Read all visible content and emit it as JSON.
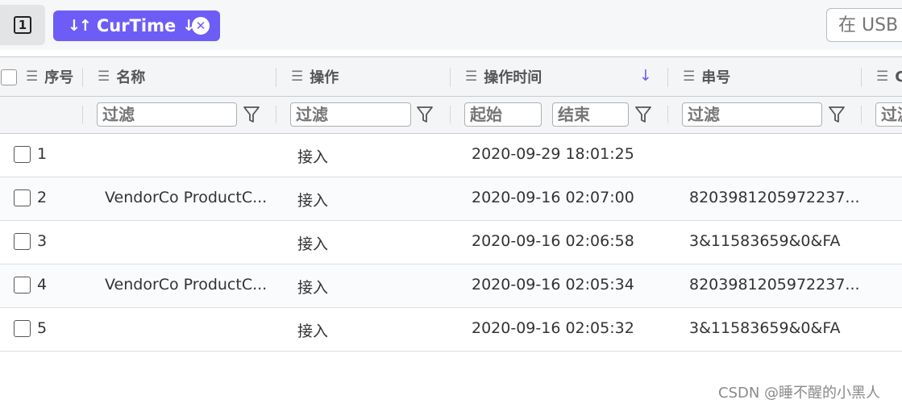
{
  "toolbar": {
    "page_number": "1",
    "sort_chip": {
      "label": "CurTime",
      "sort_icon": "sort-toggle-icon",
      "direction_icon": "arrow-down-icon",
      "close_icon": "close-circle-icon"
    },
    "search_placeholder": "在 USB"
  },
  "table": {
    "columns": [
      {
        "label": "序号"
      },
      {
        "label": "名称"
      },
      {
        "label": "操作"
      },
      {
        "label": "操作时间",
        "sorted": "desc"
      },
      {
        "label": "串号"
      },
      {
        "label": "C"
      }
    ],
    "filters": {
      "name": "过滤",
      "operation": "过滤",
      "time_start": "起始",
      "time_end": "结束",
      "serial": "过滤",
      "next": "过滤"
    },
    "rows": [
      {
        "index": "1",
        "name": "",
        "operation": "接入",
        "time": "2020-09-29 18:01:25",
        "serial": ""
      },
      {
        "index": "2",
        "name": "VendorCo ProductC...",
        "operation": "接入",
        "time": "2020-09-16 02:07:00",
        "serial": "8203981205972237..."
      },
      {
        "index": "3",
        "name": "",
        "operation": "接入",
        "time": "2020-09-16 02:06:58",
        "serial": "3&11583659&0&FA"
      },
      {
        "index": "4",
        "name": "VendorCo ProductC...",
        "operation": "接入",
        "time": "2020-09-16 02:05:34",
        "serial": "8203981205972237..."
      },
      {
        "index": "5",
        "name": "",
        "operation": "接入",
        "time": "2020-09-16 02:05:32",
        "serial": "3&11583659&0&FA"
      }
    ]
  },
  "watermark": "CSDN @睡不醒的小黑人",
  "colors": {
    "accent": "#6d5df6",
    "header_bg": "#f4f5f6"
  }
}
